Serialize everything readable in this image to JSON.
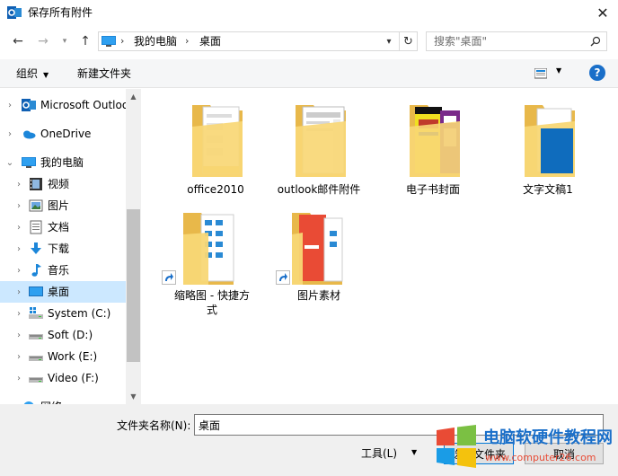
{
  "window": {
    "title": "保存所有附件"
  },
  "address": {
    "crumbs": [
      "我的电脑",
      "桌面"
    ]
  },
  "search": {
    "placeholder": "搜索\"桌面\""
  },
  "toolbar": {
    "organize": "组织",
    "new_folder": "新建文件夹"
  },
  "sidebar": {
    "items": [
      {
        "label": "Microsoft Outloo",
        "icon": "outlook-icon"
      },
      {
        "label": "OneDrive",
        "icon": "onedrive-icon"
      },
      {
        "label": "我的电脑",
        "icon": "computer-icon"
      },
      {
        "label": "视频",
        "icon": "video-folder-icon"
      },
      {
        "label": "图片",
        "icon": "pictures-folder-icon"
      },
      {
        "label": "文档",
        "icon": "documents-folder-icon"
      },
      {
        "label": "下载",
        "icon": "downloads-folder-icon"
      },
      {
        "label": "音乐",
        "icon": "music-folder-icon"
      },
      {
        "label": "桌面",
        "icon": "desktop-folder-icon"
      },
      {
        "label": "System (C:)",
        "icon": "system-drive-icon"
      },
      {
        "label": "Soft (D:)",
        "icon": "drive-icon"
      },
      {
        "label": "Work (E:)",
        "icon": "drive-icon"
      },
      {
        "label": "Video (F:)",
        "icon": "drive-icon"
      },
      {
        "label": "网络",
        "icon": "network-icon"
      }
    ]
  },
  "files": [
    {
      "name": "office2010",
      "icon": "folder-icon"
    },
    {
      "name": "outlook邮件附件",
      "icon": "folder-icon"
    },
    {
      "name": "电子书封面",
      "icon": "folder-icon"
    },
    {
      "name": "文字文稿1",
      "icon": "folder-icon"
    },
    {
      "name": "缩略图 - 快捷方",
      "name2": "式",
      "icon": "folder-shortcut-icon"
    },
    {
      "name": "图片素材",
      "icon": "folder-shortcut-icon"
    }
  ],
  "bottom": {
    "folder_name_label": "文件夹名称(N):",
    "folder_name_value": "桌面",
    "tools": "工具(L)",
    "ok": "选择文件夹",
    "cancel": "取消"
  },
  "watermark": {
    "text": "电脑软硬件教程网",
    "url": "www.computer26.com"
  },
  "colors": {
    "accent": "#1a6fc9",
    "selection": "#cce8ff",
    "folder": "#f8d775"
  }
}
